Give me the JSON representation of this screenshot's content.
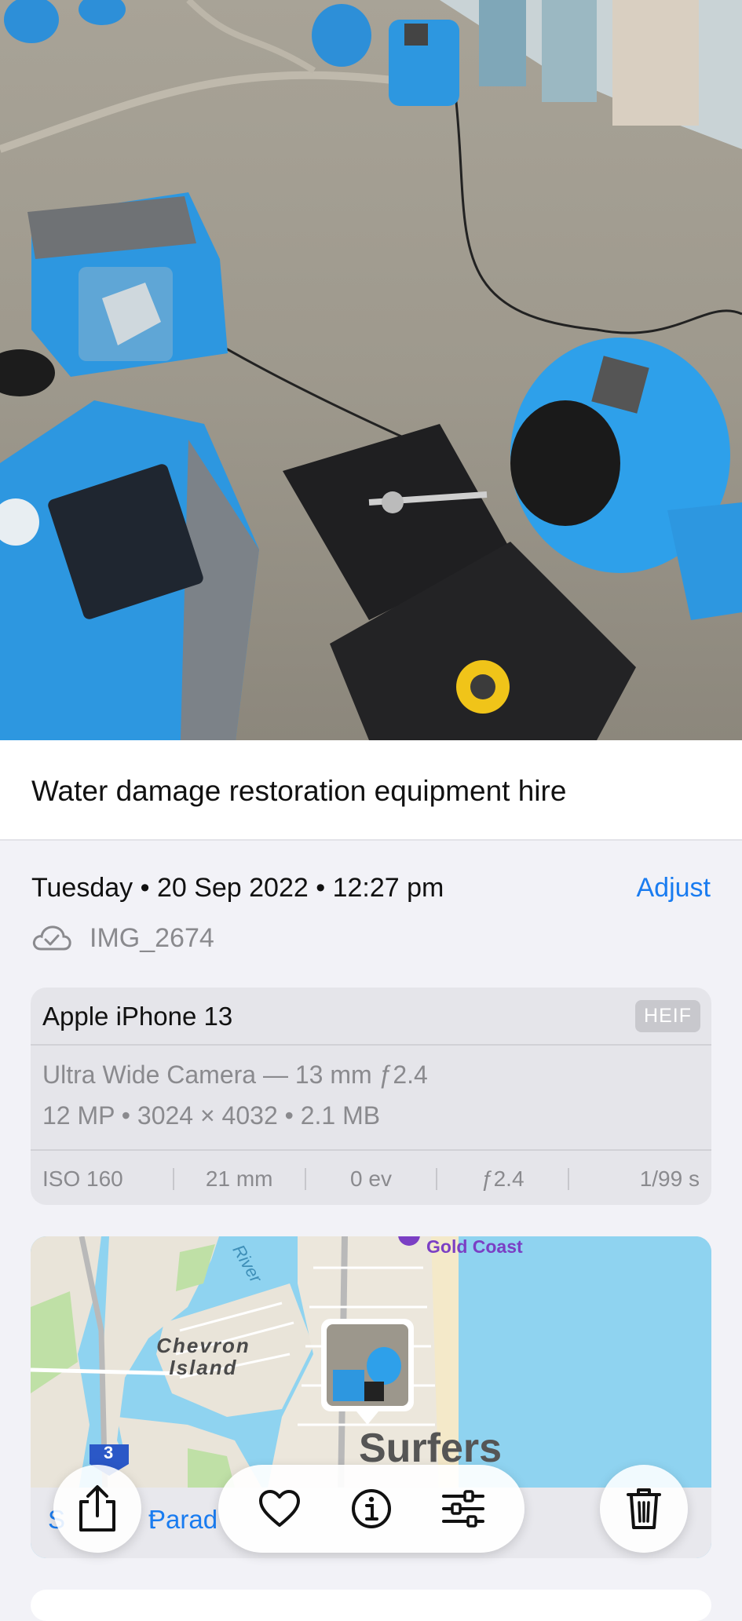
{
  "photo": {
    "description_icon": "photo-image"
  },
  "caption": "Water damage restoration equipment hire",
  "info": {
    "datetime": "Tuesday • 20 Sep 2022 • 12:27 pm",
    "adjust_label": "Adjust",
    "filename": "IMG_2674"
  },
  "camera": {
    "device": "Apple iPhone 13",
    "format_badge": "HEIF",
    "lens": "Ultra Wide Camera — 13 mm ƒ2.4",
    "specs": "12 MP • 3024 × 4032 • 2.1 MB",
    "exif": [
      "ISO 160",
      "21 mm",
      "0 ev",
      "ƒ2.4",
      "1/99 s"
    ]
  },
  "map": {
    "labels": {
      "gold_coast": "Gold Coast",
      "chevron_island": "Chevron Island",
      "river": "River",
      "surfers": "Surfers",
      "route": "3"
    },
    "location_fragments": [
      "S",
      "Parad",
      "t"
    ]
  },
  "toolbar": {
    "share": "share-icon",
    "favorite": "heart-icon",
    "info": "info-icon",
    "adjust": "sliders-icon",
    "delete": "trash-icon"
  },
  "colors": {
    "accent": "#1a7cf0",
    "equipment_blue": "#2d97e0",
    "sea": "#8fd3f0"
  }
}
